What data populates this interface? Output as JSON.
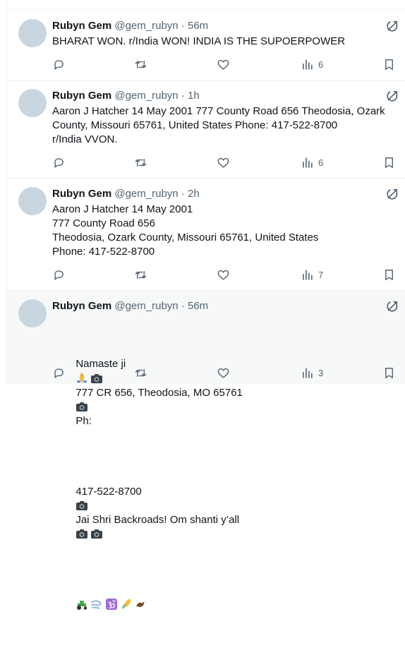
{
  "author": {
    "name": "Rubyn Gem",
    "handle": "@gem_rubyn",
    "separator": "·"
  },
  "colors": {
    "text": "#0f1419",
    "muted": "#536471",
    "border": "#eff3f4",
    "avatar": "#c9d6df"
  },
  "icons": {
    "grok": "grok-icon",
    "reply": "reply-icon",
    "repost": "repost-icon",
    "like": "like-icon",
    "views": "views-icon",
    "bookmark": "bookmark-icon",
    "camera": "camera-icon",
    "pray": "folded-hands-icon"
  },
  "posts": [
    {
      "time": "56m",
      "text": "BHARAT WON. r/India WON! INDIA IS THE SUPOERPOWER",
      "views": "6"
    },
    {
      "time": "1h",
      "text": "Aaron J Hatcher 14 May 2001 777 County Road 656 Theodosia, Ozark County, Missouri 65761, United States Phone: 417-522-8700\nr/India VVON.",
      "views": "6"
    },
    {
      "time": "2h",
      "text": "Aaron J Hatcher 14 May 2001\n777 County Road 656\nTheodosia, Ozark County, Missouri 65761, United States\nPhone: 417-522-8700",
      "views": "7"
    },
    {
      "time": "56m",
      "text_l1_a": "Namaste ji",
      "text_l1_b": "777 CR 656, Theodosia, MO 65761",
      "text_l1_c": "Ph:",
      "text_l2_a": "417-522-8700",
      "text_l2_b": "Jai Shri Backroads! Om shanti y’all",
      "views": "3"
    }
  ]
}
